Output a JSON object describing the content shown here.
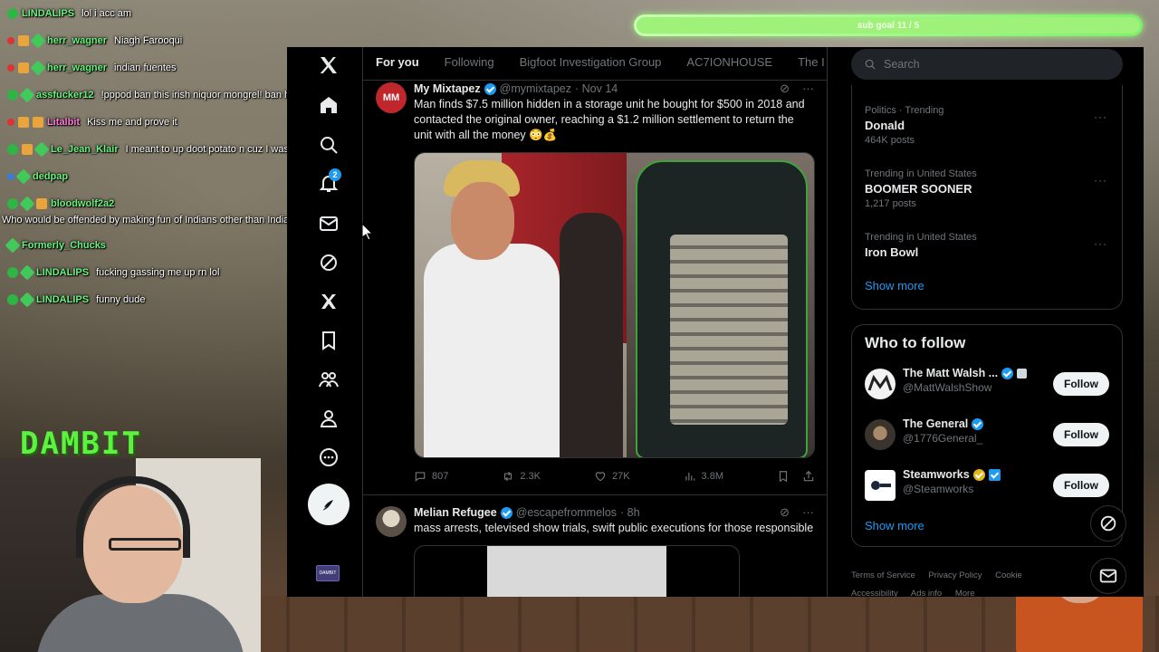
{
  "overlay": {
    "goal_label": "sub goal 11 / 5",
    "goal_fill_pct": 100,
    "brand_text": "DAMBIT"
  },
  "chat": [
    {
      "user": "LINDALIPS",
      "msg": "lol i acc am"
    },
    {
      "user": "herr_wagner",
      "msg": "Niagh Farooqui"
    },
    {
      "user": "herr_wagner",
      "msg": "indian fuentes"
    },
    {
      "user": "assfucker12",
      "msg": "!pppod ban this irish niquor mongrel! ban heem!"
    },
    {
      "user": "Litalbit",
      "msg": "Kiss me and prove it"
    },
    {
      "user": "Le_Jean_Klair",
      "msg": "I meant to up doot potato n cuz I was gonna type that"
    },
    {
      "user": "dedpap",
      "msg": ""
    },
    {
      "user": "bloodwolf2a2",
      "msg": "Who would be offended by making fun of Indians other than Indians?"
    },
    {
      "user": "Formerly_Chucks",
      "msg": ""
    },
    {
      "user": "LINDALIPS",
      "msg": "fucking gassing me up rn lol"
    },
    {
      "user": "LINDALIPS",
      "msg": "funny dude"
    }
  ],
  "nav": {
    "notifications_count": "2",
    "items": [
      "x-logo-icon",
      "home-icon",
      "search-icon",
      "notifications-icon",
      "messages-icon",
      "grok-icon",
      "premium-icon",
      "bookmarks-icon",
      "communities-icon",
      "profile-icon",
      "more-icon"
    ],
    "account_label": "DAMBIT"
  },
  "tabs": [
    "For you",
    "Following",
    "Bigfoot Investigation Group",
    "AC7IONHOUSE",
    "The I"
  ],
  "tweets": [
    {
      "name": "My Mixtapez",
      "handle": "@mymixtapez",
      "date": "· Nov 14",
      "text": "Man finds $7.5 million hidden in a storage unit he bought for $500 in 2018 and contacted the original owner, reaching a $1.2 million settlement to return the unit with all the money 😳💰",
      "replies": "807",
      "reposts": "2.3K",
      "likes": "27K",
      "views": "3.8M",
      "avatar_color": "#c0272d",
      "avatar_label": "MM"
    },
    {
      "name": "Melian Refugee",
      "handle": "@escapefrommelos",
      "date": "· 8h",
      "text": "mass arrests, televised show trials, swift public executions for those responsible"
    }
  ],
  "sidebar": {
    "search_placeholder": "Search",
    "trends": [
      {
        "meta": "Politics · Trending",
        "title": "Donald",
        "posts": "464K posts"
      },
      {
        "meta": "Trending in United States",
        "title": "BOOMER SOONER",
        "posts": "1,217 posts"
      },
      {
        "meta": "Trending in United States",
        "title": "Iron Bowl",
        "posts": ""
      }
    ],
    "show_more": "Show more",
    "who_to_follow_title": "Who to follow",
    "follow": [
      {
        "name": "The Matt Walsh ...",
        "handle": "@MattWalshShow",
        "btn": "Follow"
      },
      {
        "name": "The General",
        "handle": "@1776General_",
        "btn": "Follow"
      },
      {
        "name": "Steamworks",
        "handle": "@Steamworks",
        "btn": "Follow"
      }
    ],
    "show_more_2": "Show more",
    "footer": [
      "Terms of Service",
      "Privacy Policy",
      "Cookie",
      "Accessibility",
      "Ads info",
      "More"
    ]
  },
  "colors": {
    "accent": "#1d9bf0",
    "background": "#000000",
    "border": "#2f3336",
    "muted": "#71767b",
    "chat_user": "#6af27f"
  }
}
